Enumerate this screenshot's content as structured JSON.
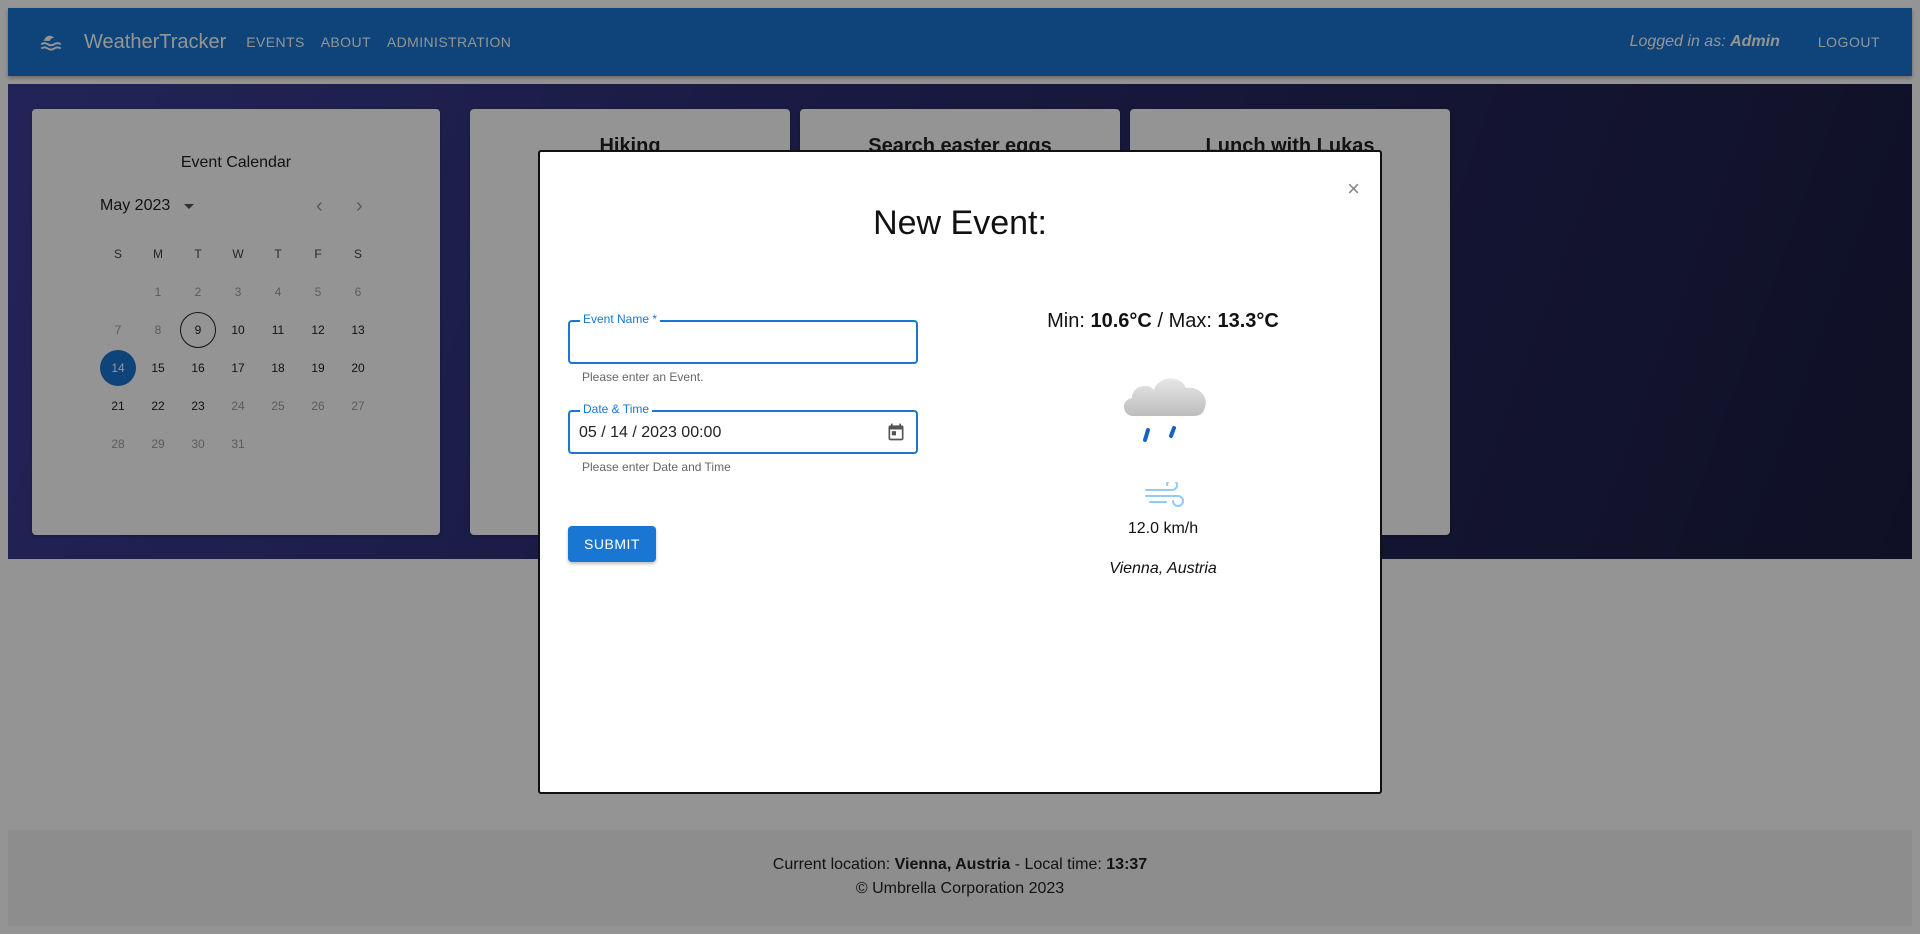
{
  "app": {
    "title": "WeatherTracker",
    "nav": [
      "EVENTS",
      "ABOUT",
      "ADMINISTRATION"
    ],
    "logged_in_prefix": "Logged in as:",
    "logged_in_user": "Admin",
    "logout_label": "LOGOUT"
  },
  "calendar": {
    "title": "Event Calendar",
    "month_label": "May 2023",
    "weekdays": [
      "S",
      "M",
      "T",
      "W",
      "T",
      "F",
      "S"
    ],
    "weeks": [
      [
        "",
        "1",
        "2",
        "3",
        "4",
        "5",
        "6"
      ],
      [
        "7",
        "8",
        "9",
        "10",
        "11",
        "12",
        "13"
      ],
      [
        "14",
        "15",
        "16",
        "17",
        "18",
        "19",
        "20"
      ],
      [
        "21",
        "22",
        "23",
        "24",
        "25",
        "26",
        "27"
      ],
      [
        "28",
        "29",
        "30",
        "31",
        "",
        "",
        ""
      ]
    ],
    "today": "9",
    "selected": "14"
  },
  "events": [
    {
      "title": "Hiking"
    },
    {
      "title": "Search easter eggs"
    },
    {
      "title": "Lunch with Lukas"
    }
  ],
  "modal": {
    "title": "New Event:",
    "close_symbol": "×",
    "name_field": {
      "label": "Event Name *",
      "value": "",
      "helper": "Please enter an Event."
    },
    "date_field": {
      "label": "Date & Time",
      "value": "05 / 14 / 2023 00:00",
      "helper": "Please enter Date and Time"
    },
    "submit_label": "SUBMIT",
    "weather": {
      "min_label": "Min:",
      "min_value": "10.6°C",
      "separator": "/",
      "max_label": "Max:",
      "max_value": "13.3°C",
      "icon": "rain-cloud-icon",
      "wind_icon": "wind-icon",
      "wind_speed": "12.0 km/h",
      "location": "Vienna, Austria"
    }
  },
  "footer": {
    "location_prefix": "Current location:",
    "location_value": "Vienna, Austria",
    "time_prefix": "- Local time:",
    "time_value": "13:37",
    "copyright": "© Umbrella Corporation 2023"
  },
  "colors": {
    "primary": "#1976d2",
    "hero_gradient_start": "#3c3f9a",
    "hero_gradient_end": "#1b1c40"
  }
}
